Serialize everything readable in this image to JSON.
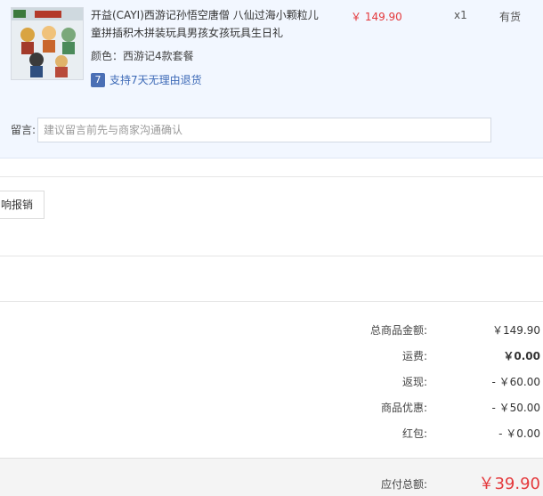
{
  "product": {
    "title": "开益(CAYI)西游记孙悟空唐僧 八仙过海小颗粒儿童拼插积木拼装玩具男孩女孩玩具生日礼",
    "price": "￥ 149.90",
    "quantity": "x1",
    "stock": "有货",
    "color_label": "颜色：西游记4款套餐",
    "return_badge": "7",
    "return_text": "支持7天无理由退货"
  },
  "remark": {
    "label": "留言:",
    "placeholder": "建议留言前先与商家沟通确认"
  },
  "report_button": "响报销",
  "summary": {
    "rows": [
      {
        "label": "总商品金额:",
        "value": "￥149.90"
      },
      {
        "label": "运费:",
        "value": "￥0.00"
      },
      {
        "label": "返现:",
        "value": "- ￥60.00"
      },
      {
        "label": "商品优惠:",
        "value": "- ￥50.00"
      },
      {
        "label": "红包:",
        "value": "- ￥0.00"
      }
    ],
    "total_label": "应付总额:",
    "total_value": "￥39.90"
  },
  "colors": {
    "price_red": "#e4393c",
    "item_bg": "#f2f7ff",
    "link_blue": "#3d6ab7"
  }
}
